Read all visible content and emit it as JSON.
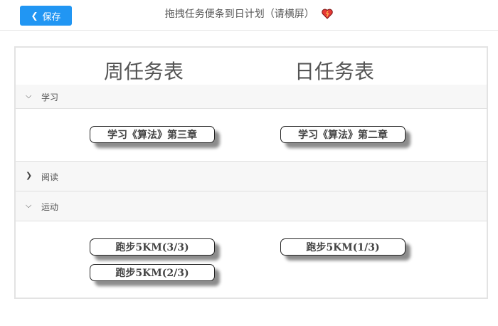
{
  "header": {
    "save_label": "保存",
    "title": "拖拽任务便条到日计划（请横屏）",
    "heart_color": "#e53935"
  },
  "board": {
    "week_title": "周任务表",
    "day_title": "日任务表",
    "sections": [
      {
        "label": "学习",
        "expanded": true,
        "week_tasks": [
          "学习《算法》第三章"
        ],
        "day_tasks": [
          "学习《算法》第二章"
        ]
      },
      {
        "label": "阅读",
        "expanded": false,
        "week_tasks": [],
        "day_tasks": []
      },
      {
        "label": "运动",
        "expanded": true,
        "week_tasks": [
          "跑步5KM(3/3)",
          "跑步5KM(2/3)"
        ],
        "day_tasks": [
          "跑步5KM(1/3)"
        ]
      }
    ]
  }
}
